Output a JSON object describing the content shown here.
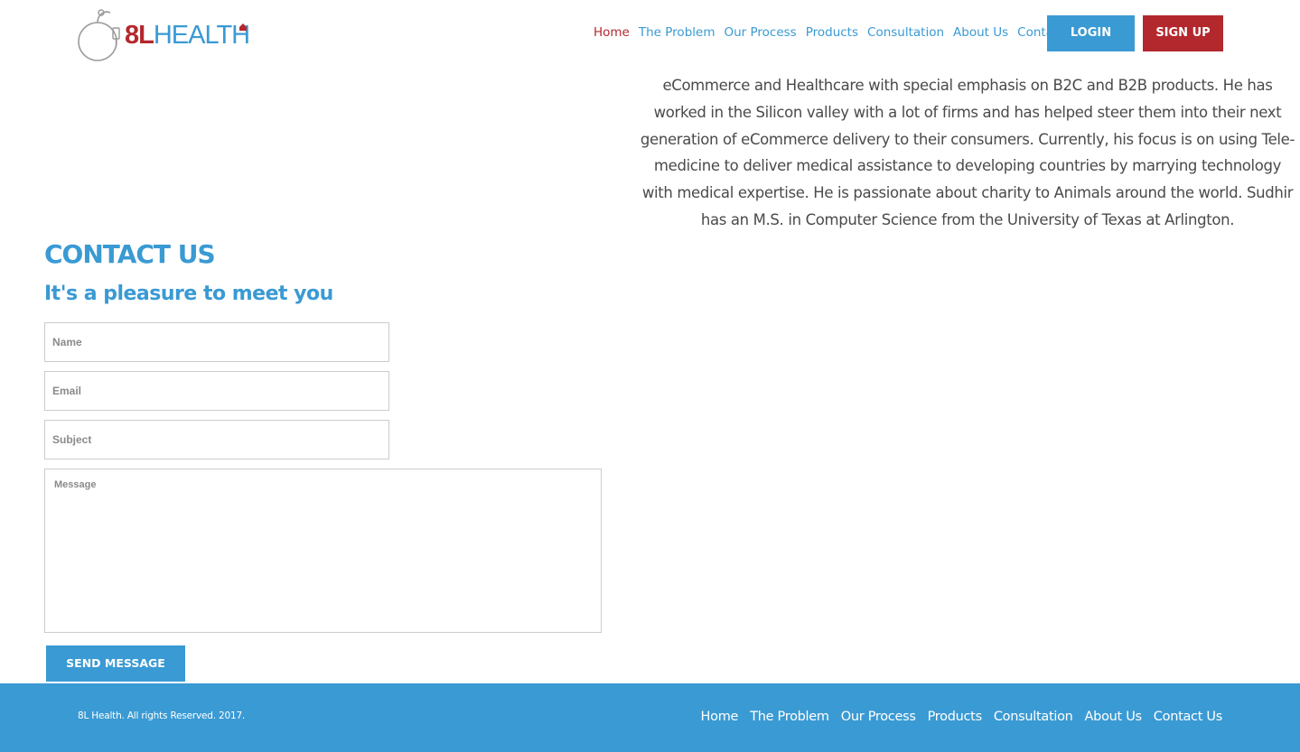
{
  "brand": {
    "logo_prefix": "8L",
    "logo_suffix": "HEALTH",
    "colors": {
      "primary": "#3a9ad3",
      "accent": "#b3282d"
    }
  },
  "nav": {
    "items": [
      {
        "label": "Home",
        "active": true
      },
      {
        "label": "The Problem"
      },
      {
        "label": "Our Process"
      },
      {
        "label": "Products"
      },
      {
        "label": "Consultation"
      },
      {
        "label": "About Us"
      },
      {
        "label": "Contact Us"
      }
    ],
    "login": "LOGIN",
    "signup": "SIGN UP"
  },
  "bio": {
    "text": "eCommerce and Healthcare with special emphasis on B2C and B2B products. He has worked in the Silicon valley with a lot of firms and has helped steer them into their next generation of eCommerce delivery to their consumers. Currently, his focus is on using Tele-medicine to deliver medical assistance to developing countries by marrying technology with medical expertise. He is passionate about charity to Animals around the world. Sudhir has an M.S. in Computer Science from the University of Texas at Arlington."
  },
  "contact": {
    "title": "CONTACT US",
    "subtitle": "It's a pleasure to meet you",
    "name_placeholder": "Name",
    "email_placeholder": "Email",
    "subject_placeholder": "Subject",
    "message_placeholder": "Message",
    "send": "SEND MESSAGE"
  },
  "footer": {
    "copyright": "8L Health. All rights Reserved. 2017.",
    "links": [
      "Home",
      "The Problem",
      "Our Process",
      "Products",
      "Consultation",
      "About Us",
      "Contact Us"
    ]
  }
}
